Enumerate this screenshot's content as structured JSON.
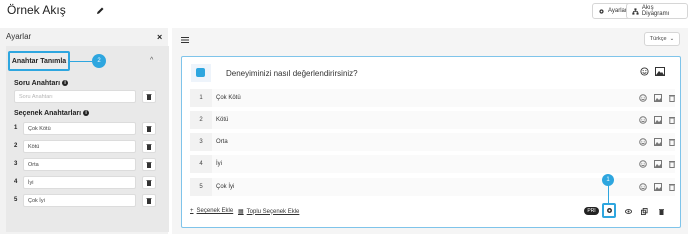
{
  "header": {
    "title": "Örnek Akış",
    "settings_label": "Ayarlar",
    "diagram_label": "Akış Diyagramı"
  },
  "sidebar": {
    "title": "Ayarlar",
    "section_title": "Anahtar Tanımla",
    "callout_number": "2",
    "question_keys_label": "Soru Anahtarı",
    "question_key_placeholder": "Soru Anahtarı",
    "option_keys_label": "Seçenek Anahtarları",
    "option_keys": [
      {
        "num": "1",
        "value": "Çok Kötü"
      },
      {
        "num": "2",
        "value": "Kötü"
      },
      {
        "num": "3",
        "value": "Orta"
      },
      {
        "num": "4",
        "value": "İyi"
      },
      {
        "num": "5",
        "value": "Çok İyi"
      }
    ]
  },
  "main": {
    "language": "Türkçe",
    "question": "Deneyiminizi nasıl değerlendirirsiniz?",
    "options": [
      {
        "num": "1",
        "label": "Çok Kötü"
      },
      {
        "num": "2",
        "label": "Kötü"
      },
      {
        "num": "3",
        "label": "Orta"
      },
      {
        "num": "4",
        "label": "İyi"
      },
      {
        "num": "5",
        "label": "Çok İyi"
      }
    ],
    "add_option": "Seçenek Ekle",
    "bulk_add_option": "Toplu Seçenek Ekle",
    "pill_label": "PRI",
    "callout_number": "1"
  },
  "colors": {
    "accent": "#2ea6df",
    "sidebar_bg": "#f2f2f2",
    "main_bg": "#f5f5f5"
  }
}
